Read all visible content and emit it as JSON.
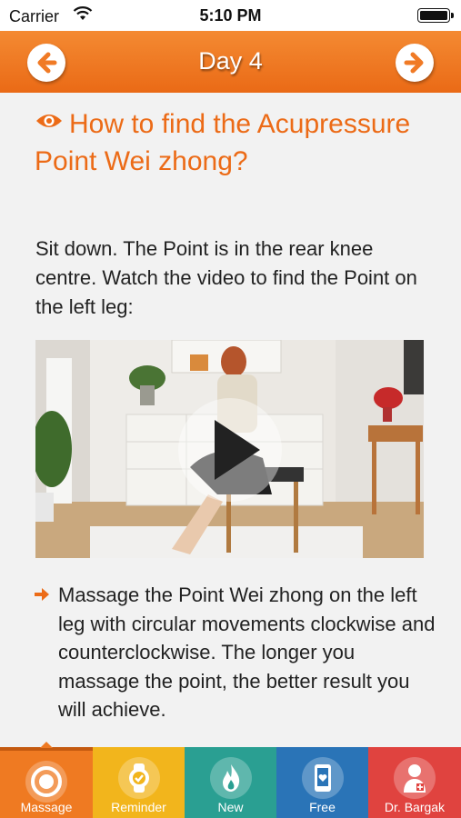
{
  "status_bar": {
    "carrier": "Carrier",
    "time": "5:10 PM"
  },
  "nav": {
    "title": "Day 4",
    "prev_icon": "arrow-left-icon",
    "next_icon": "arrow-right-icon"
  },
  "content": {
    "heading": "How to find the Acupressure Point Wei zhong?",
    "intro": "Sit down. The Point is in the rear knee centre. Watch the video to find the Point on the left leg:",
    "instruction": "Massage the Point Wei zhong on the left leg with circular movements clockwise and counterclockwise. The longer you massage the point, the better result you will achieve."
  },
  "tabs": [
    {
      "label": "Massage",
      "icon": "target-icon",
      "color": "#ef7a22",
      "selected": true
    },
    {
      "label": "Reminder",
      "icon": "watch-icon",
      "color": "#f2b51c"
    },
    {
      "label": "New",
      "icon": "flame-icon",
      "color": "#2a9f92"
    },
    {
      "label": "Free",
      "icon": "phone-heart-icon",
      "color": "#2a74b7"
    },
    {
      "label": "Dr. Bargak",
      "icon": "doctor-icon",
      "color": "#e0433f"
    }
  ],
  "accent_color": "#ec6b17"
}
